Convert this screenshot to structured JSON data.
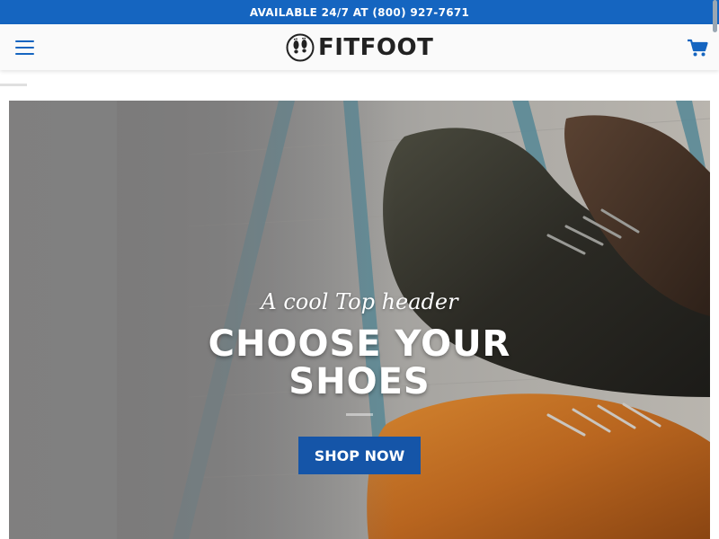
{
  "topbar": {
    "text": "AVAILABLE 24/7 AT (800) 927-7671"
  },
  "header": {
    "menu_icon": "hamburger-menu-icon",
    "logo_text": "FITFOOT",
    "logo_icon": "footprints-icon",
    "cart_icon": "shopping-cart-icon"
  },
  "hero": {
    "subtitle": "A cool Top header",
    "title_line1": "CHOOSE YOUR",
    "title_line2": "SHOES",
    "button_label": "SHOP NOW"
  },
  "colors": {
    "brand_blue": "#1565c0",
    "button_blue": "#1555a8",
    "header_bg": "#fafafa"
  }
}
